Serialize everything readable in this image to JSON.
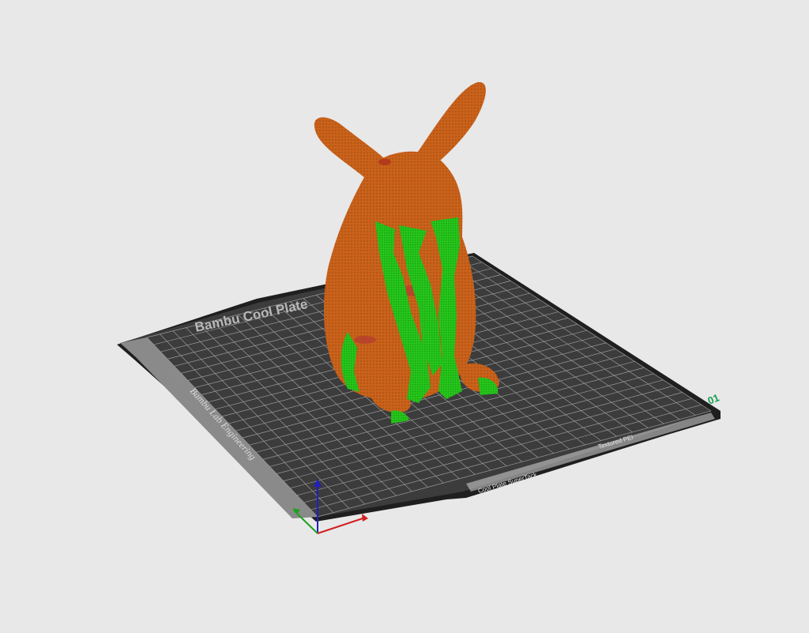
{
  "plate": {
    "brand_text": "Bambu Cool Plate",
    "side_text": "Bambu Lab Engineering",
    "bottom_label_1": "Cool Plate SuperTack",
    "bottom_label_2": "Textured PEI",
    "plate_number": "01"
  },
  "colors": {
    "background": "#e8e8e8",
    "plate_dark": "#3c3c3c",
    "plate_light_strip": "#8a8a8a",
    "plate_border": "#1f1f1f",
    "grid_line": "#9a9a9a",
    "model": "#c9621a",
    "model_shadow": "#9a4512",
    "support": "#22c11a",
    "support_dark": "#159610",
    "plate_number_color": "#14a050",
    "axis_x": "#d22020",
    "axis_y": "#20a020",
    "axis_z": "#2020c0"
  },
  "icons": {
    "axis_gizmo": "xyz-axis-icon"
  }
}
